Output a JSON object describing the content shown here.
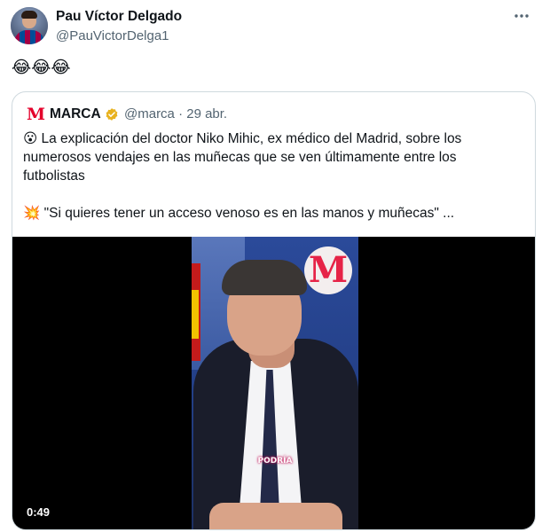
{
  "tweet": {
    "author_name": "Pau Víctor Delgado",
    "author_handle": "@PauVictorDelga1",
    "more_icon": "more-horizontal-icon",
    "text": "😂😂😂"
  },
  "quoted_tweet": {
    "author_name": "MARCA",
    "logo_letter": "M",
    "verified_color": "#e8b21f",
    "handle_and_date": "@marca · 29 abr.",
    "lines": [
      {
        "emoji": "😮",
        "text": " La explicación del doctor Niko Mihic, ex médico del Madrid, sobre los"
      },
      {
        "emoji": "",
        "text": "numerosos vendajes en las muñecas que se ven últimamente entre los"
      },
      {
        "emoji": "",
        "text": "futbolistas"
      },
      {
        "emoji": "",
        "text": ""
      },
      {
        "emoji": "💥",
        "text": " \"Si quieres tener un acceso venoso es en las manos y muñecas\"  ..."
      }
    ]
  },
  "video": {
    "duration": "0:49",
    "caption": "PODRÍA",
    "watermark_letter": "M"
  },
  "colors": {
    "brand_red": "#e4002b",
    "text_primary": "#0f1419",
    "text_secondary": "#536471",
    "border": "#cfd9de"
  }
}
